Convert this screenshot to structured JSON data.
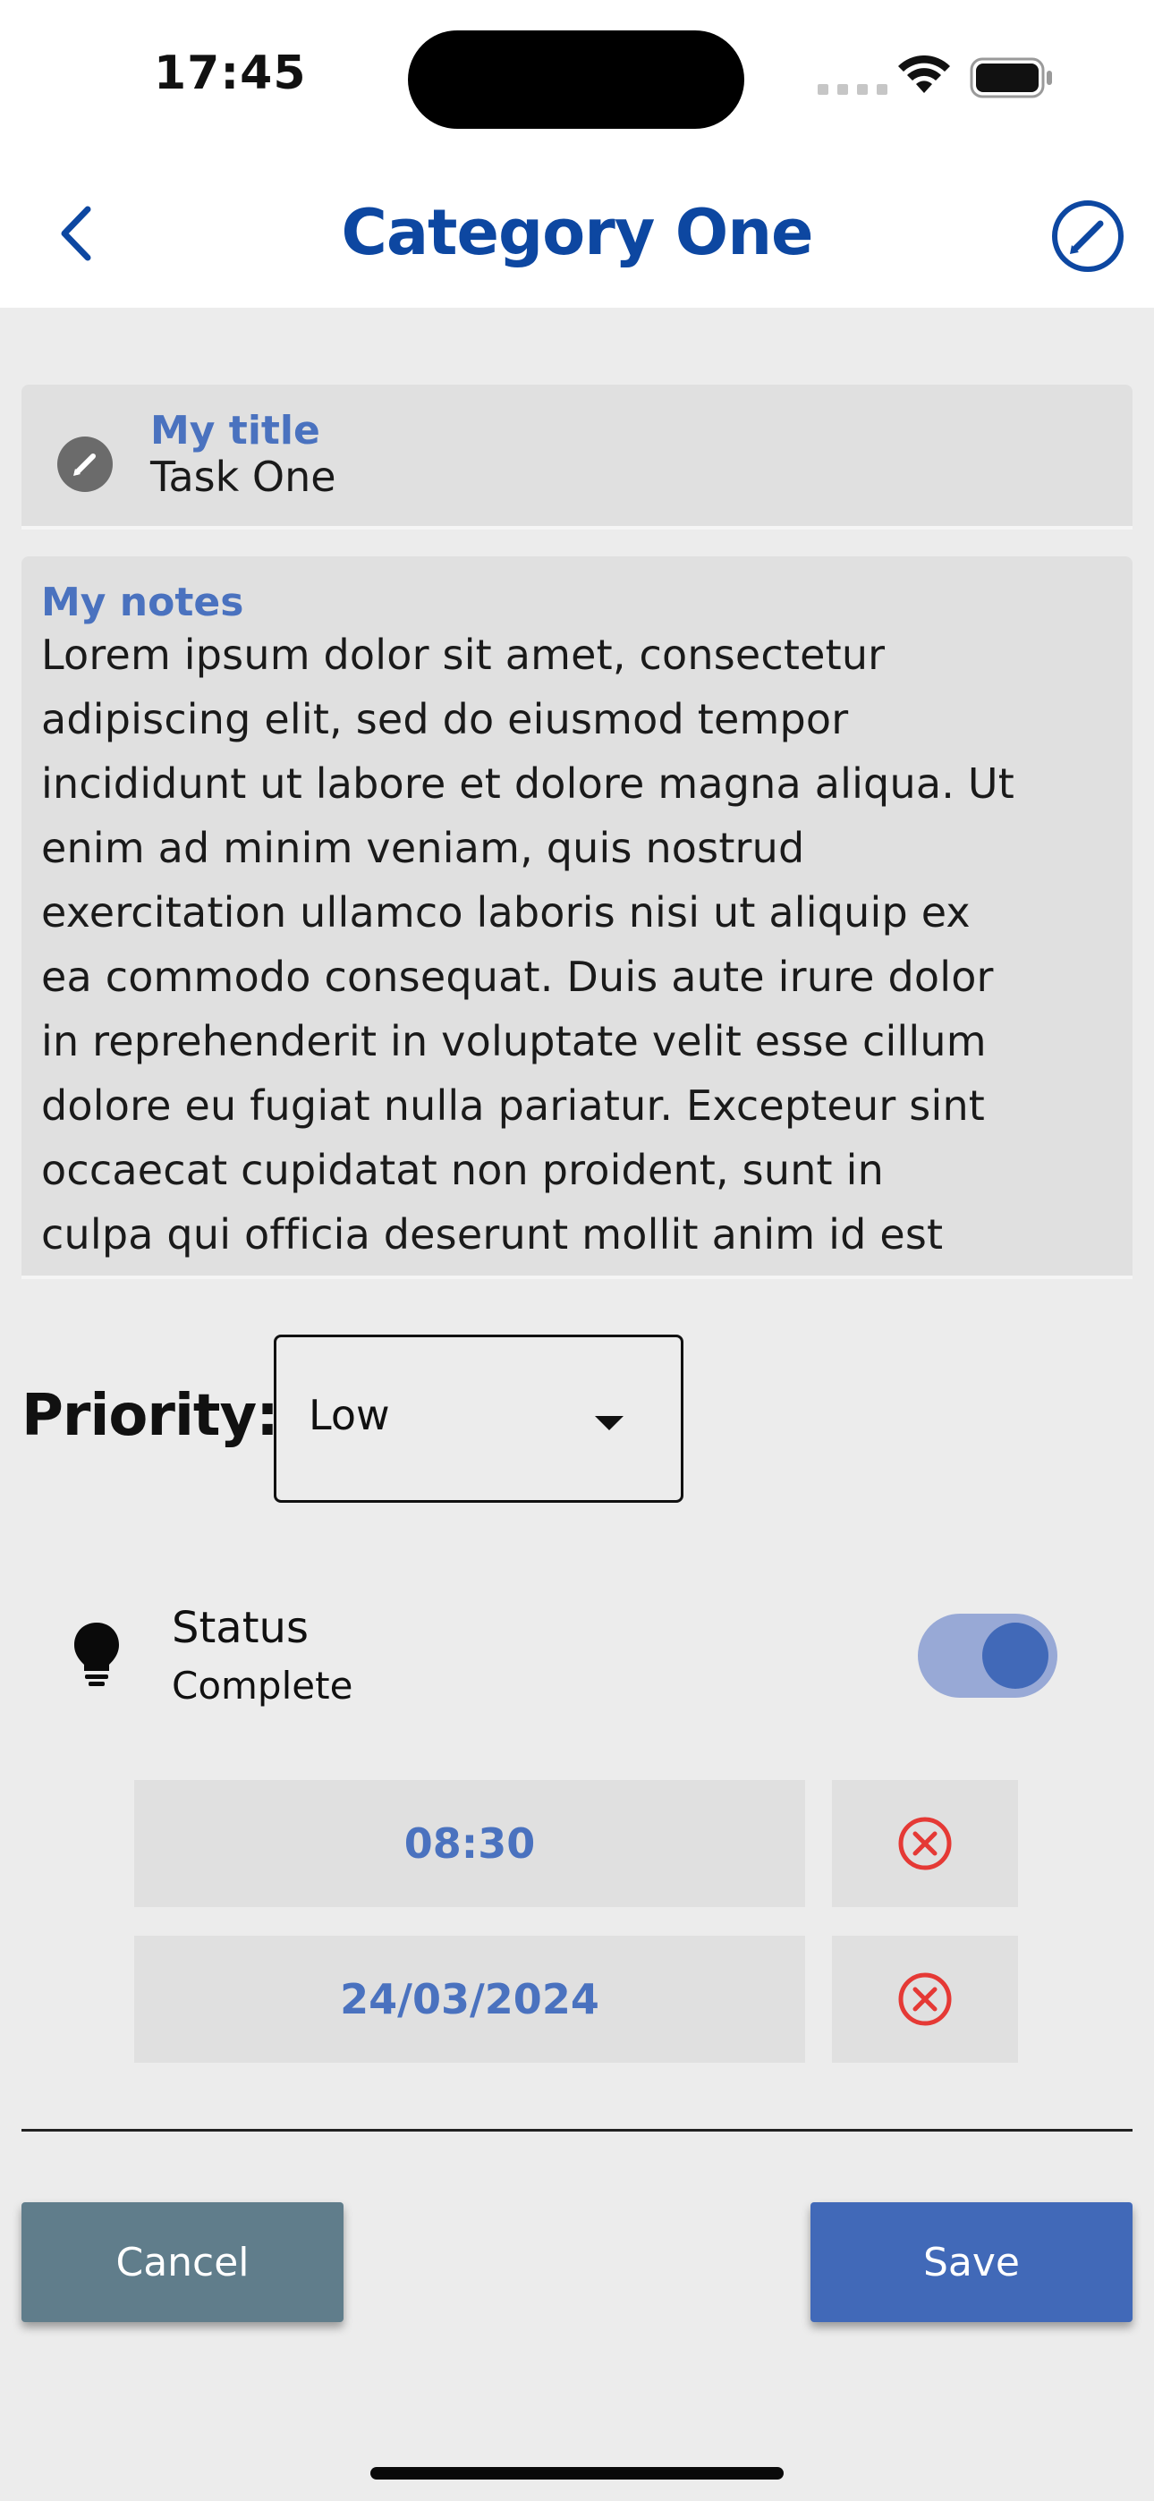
{
  "status_bar": {
    "time": "17:45"
  },
  "header": {
    "title": "Category One",
    "back_icon": "chevron-left-icon",
    "edit_icon": "edit-circle-icon",
    "accent_color": "#0d47a1"
  },
  "title_field": {
    "label": "My title",
    "value": "Task One",
    "icon": "pencil-icon"
  },
  "notes_field": {
    "label": "My notes",
    "value": "Lorem ipsum dolor sit amet, consectetur\nadipiscing elit, sed do eiusmod tempor\nincididunt ut labore et dolore magna aliqua. Ut\nenim ad minim veniam, quis nostrud\nexercitation ullamco laboris nisi ut aliquip ex\nea commodo consequat. Duis aute irure dolor\nin reprehenderit in voluptate velit esse cillum\ndolore eu fugiat nulla pariatur. Excepteur sint\noccaecat cupidatat non proident, sunt in\nculpa qui officia deserunt mollit anim id est"
  },
  "priority": {
    "label": "Priority:",
    "selected": "Low"
  },
  "status": {
    "title": "Status",
    "value": "Complete",
    "icon": "lightbulb-icon",
    "toggle_on": true
  },
  "time_field": {
    "value": "08:30",
    "clear_icon": "clear-circle-icon"
  },
  "date_field": {
    "value": "24/03/2024",
    "clear_icon": "clear-circle-icon"
  },
  "actions": {
    "cancel_label": "Cancel",
    "save_label": "Save"
  },
  "colors": {
    "field_label": "#4a72bf",
    "clear_icon": "#e53935",
    "cancel_button": "#607d8b",
    "save_button": "#4169b8"
  }
}
